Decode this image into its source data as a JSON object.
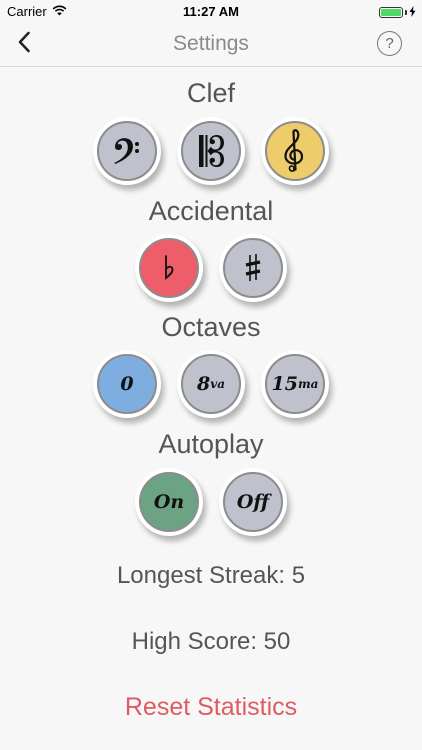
{
  "status_bar": {
    "carrier": "Carrier",
    "time": "11:27 AM",
    "battery_color": "#4cd964"
  },
  "nav": {
    "title": "Settings",
    "back_icon": "chevron-left-icon",
    "help_label": "?"
  },
  "clef": {
    "title": "Clef",
    "options": [
      {
        "name": "bass",
        "symbol": "𝄢",
        "color": "#bfc2cc",
        "selected": false
      },
      {
        "name": "alto",
        "symbol": "𝄡",
        "color": "#bfc2cc",
        "selected": false
      },
      {
        "name": "treble",
        "symbol": "𝄞",
        "color": "#efcc6a",
        "selected": true
      }
    ]
  },
  "accidental": {
    "title": "Accidental",
    "options": [
      {
        "name": "flat",
        "symbol": "♭",
        "color": "#ef5d6b",
        "selected": true
      },
      {
        "name": "sharp",
        "symbol": "♯",
        "color": "#bfc2cc",
        "selected": false
      }
    ]
  },
  "octaves": {
    "title": "Octaves",
    "options": [
      {
        "name": "zero",
        "label": "0",
        "sup": "",
        "color": "#7eaee0",
        "selected": true
      },
      {
        "name": "8va",
        "label": "8",
        "sup": "va",
        "color": "#bfc2cc",
        "selected": false
      },
      {
        "name": "15ma",
        "label": "15",
        "sup": "ma",
        "color": "#bfc2cc",
        "selected": false
      }
    ]
  },
  "autoplay": {
    "title": "Autoplay",
    "options": [
      {
        "name": "on",
        "label": "On",
        "color": "#6ba384",
        "selected": true
      },
      {
        "name": "off",
        "label": "Off",
        "color": "#bfc2cc",
        "selected": false
      }
    ]
  },
  "stats": {
    "longest_streak": "Longest Streak: 5",
    "high_score": "High Score: 50"
  },
  "reset_label": "Reset Statistics"
}
